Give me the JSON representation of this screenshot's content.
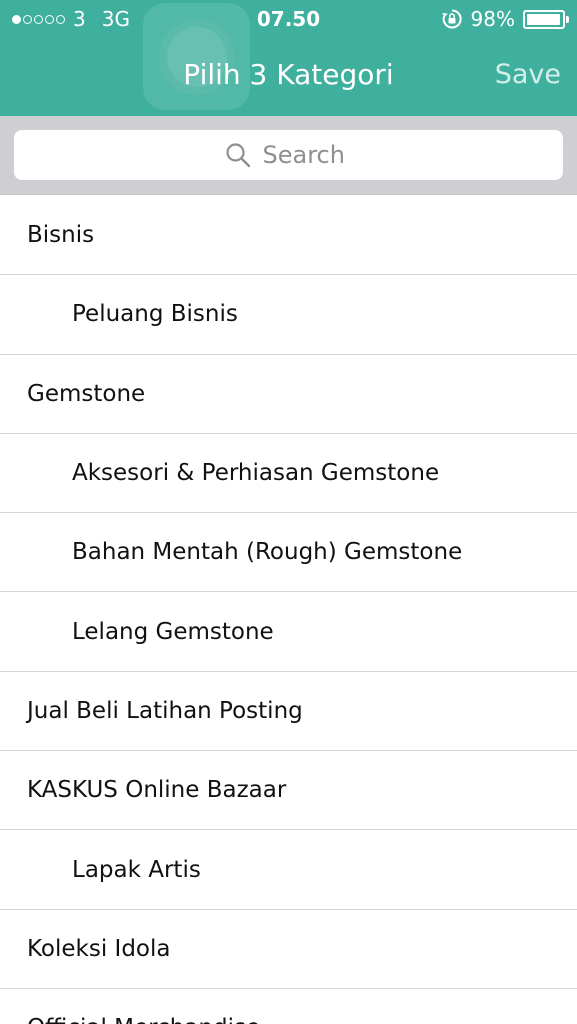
{
  "status_bar": {
    "carrier": "3",
    "network": "3G",
    "time": "07.50",
    "battery_percent": "98%",
    "battery_level": 0.98,
    "signal_bars_filled": 1,
    "signal_bars_total": 5
  },
  "nav": {
    "title": "Pilih 3 Kategori",
    "save_label": "Save"
  },
  "search": {
    "placeholder": "Search"
  },
  "colors": {
    "header": "#3fb09e",
    "search_bar_bg": "#cfcfd3",
    "separator": "#d6d6d6"
  },
  "categories": [
    {
      "label": "Bisnis",
      "level": 0
    },
    {
      "label": "Peluang Bisnis",
      "level": 1
    },
    {
      "label": "Gemstone",
      "level": 0
    },
    {
      "label": "Aksesori & Perhiasan Gemstone",
      "level": 1
    },
    {
      "label": "Bahan Mentah (Rough) Gemstone",
      "level": 1
    },
    {
      "label": "Lelang Gemstone",
      "level": 1
    },
    {
      "label": "Jual Beli Latihan Posting",
      "level": 0
    },
    {
      "label": "KASKUS Online Bazaar",
      "level": 0
    },
    {
      "label": "Lapak Artis",
      "level": 1
    },
    {
      "label": "Koleksi Idola",
      "level": 0
    },
    {
      "label": "Official Merchandise",
      "level": 0
    }
  ]
}
